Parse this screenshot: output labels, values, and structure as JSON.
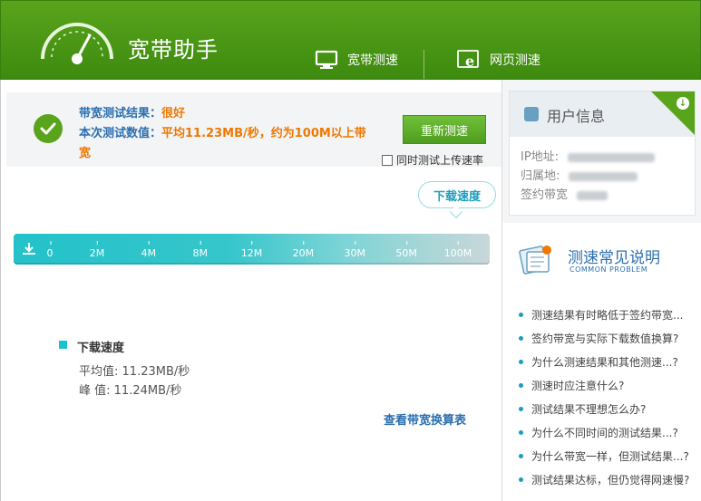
{
  "header": {
    "app_title": "宽带助手",
    "nav": [
      {
        "label": "宽带测速",
        "icon": "monitor-icon"
      },
      {
        "label": "网页测速",
        "icon": "ie-browser-icon"
      }
    ]
  },
  "result": {
    "line1_label": "带宽测试结果：",
    "line1_value": "很好",
    "line2_label": "本次测试数值：",
    "line2_value": "平均11.23MB/秒，约为100M以上带",
    "line2_wrap": "宽",
    "retest_button": "重新测速",
    "upload_checkbox": "同时测试上传速率"
  },
  "gauge": {
    "bubble_label": "下载速度",
    "ticks": [
      "0",
      "2M",
      "4M",
      "8M",
      "12M",
      "20M",
      "30M",
      "50M",
      "100M"
    ],
    "level": 0.94
  },
  "stats": {
    "title": "下载速度",
    "avg_label": "平均值:",
    "avg_value": "11.23MB/秒",
    "peak_label": "峰 值:",
    "peak_value": "11.24MB/秒",
    "link": "查看带宽换算表"
  },
  "user_info": {
    "title": "用户信息",
    "rows": [
      {
        "label": "IP地址:"
      },
      {
        "label": "归属地:"
      },
      {
        "label": "签约带宽"
      }
    ]
  },
  "faq": {
    "title": "测速常见说明",
    "subtitle": "COMMON PROBLEM",
    "items": [
      "测速结果有时略低于签约带宽...",
      "签约带宽与实际下载数值换算?",
      "为什么测速结果和其他测速...?",
      "测速时应注意什么?",
      "测试结果不理想怎么办?",
      "为什么不同时间的测试结果...?",
      "为什么带宽一样，但测试结果...?",
      "测试结果达标，但仍觉得网速慢?"
    ]
  },
  "colors": {
    "brand_green": "#4f9d1f",
    "accent_blue": "#2c6fae",
    "result_orange": "#f07800",
    "gauge_cyan": "#23c2c9"
  }
}
